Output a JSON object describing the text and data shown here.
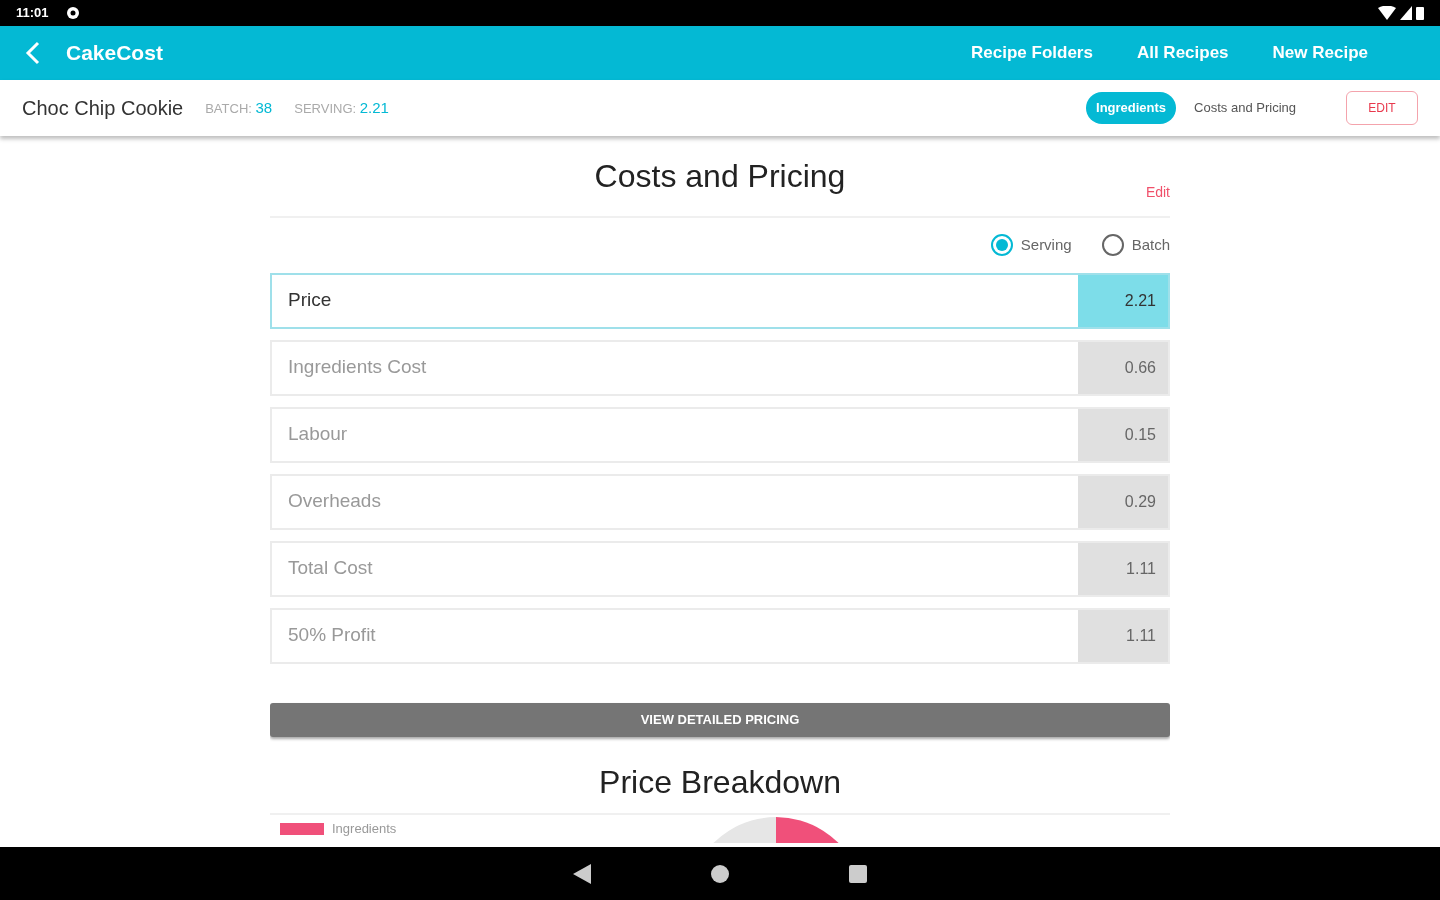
{
  "status_bar": {
    "time": "11:01"
  },
  "app_bar": {
    "title": "CakeCost",
    "nav": [
      "Recipe Folders",
      "All Recipes",
      "New Recipe"
    ]
  },
  "recipe": {
    "name": "Choc Chip Cookie",
    "batch_label": "BATCH:",
    "batch": "38",
    "serving_label": "SERVING:",
    "serving": "2.21"
  },
  "tabs": [
    {
      "label": "Ingredients",
      "selected": true
    },
    {
      "label": "Costs and Pricing",
      "selected": false
    }
  ],
  "edit_button": "EDIT",
  "costs": {
    "title": "Costs and Pricing",
    "edit_link": "Edit",
    "modes": [
      {
        "label": "Serving",
        "selected": true
      },
      {
        "label": "Batch",
        "selected": false
      }
    ],
    "rows": [
      {
        "label": "Price",
        "value": "2.21",
        "highlighted": true
      },
      {
        "label": "Ingredients Cost",
        "value": "0.66",
        "highlighted": false
      },
      {
        "label": "Labour",
        "value": "0.15",
        "highlighted": false
      },
      {
        "label": "Overheads",
        "value": "0.29",
        "highlighted": false
      },
      {
        "label": "Total Cost",
        "value": "1.11",
        "highlighted": false
      },
      {
        "label": "50% Profit",
        "value": "1.11",
        "highlighted": false
      }
    ]
  },
  "detail_button": "VIEW DETAILED PRICING",
  "breakdown": {
    "title": "Price Breakdown",
    "legend": [
      {
        "label": "Ingredients",
        "color": "#f0507a"
      }
    ]
  }
}
